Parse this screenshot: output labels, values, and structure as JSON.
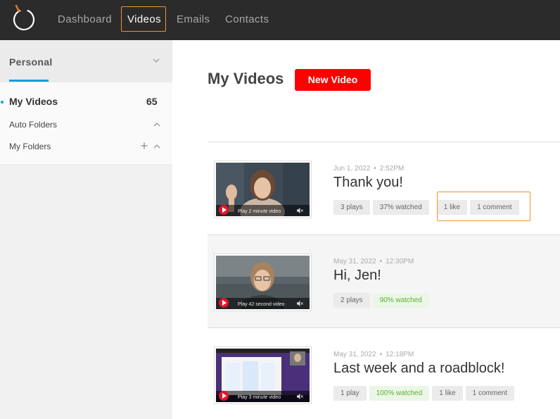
{
  "nav": {
    "items": [
      {
        "label": "Dashboard"
      },
      {
        "label": "Videos"
      },
      {
        "label": "Emails"
      },
      {
        "label": "Contacts"
      }
    ],
    "active": "Videos",
    "accent_color": "#e8952b"
  },
  "sidebar": {
    "section_label": "Personal",
    "my_videos_label": "My Videos",
    "my_videos_count": "65",
    "auto_folders_label": "Auto Folders",
    "my_folders_label": "My Folders",
    "accent_color": "#1a9bd7"
  },
  "main": {
    "title": "My Videos",
    "new_video_label": "New Video",
    "brand_color": "#ff0000"
  },
  "videos": [
    {
      "date": "Jun 1, 2022",
      "time": "2:52PM",
      "title": "Thank you!",
      "play_text": "Play 2 minute video",
      "plays": "3 plays",
      "watched": "37% watched",
      "likes": "1 like",
      "comments": "1 comment"
    },
    {
      "date": "May 31, 2022",
      "time": "12:30PM",
      "title": "Hi, Jen!",
      "play_text": "Play 42 second video",
      "plays": "2 plays",
      "watched": "90% watched"
    },
    {
      "date": "May 31, 2022",
      "time": "12:18PM",
      "title": "Last week and a roadblock!",
      "play_text": "Play 3 minute video",
      "plays": "1 play",
      "watched": "100% watched",
      "likes": "1 like",
      "comments": "1 comment"
    }
  ]
}
